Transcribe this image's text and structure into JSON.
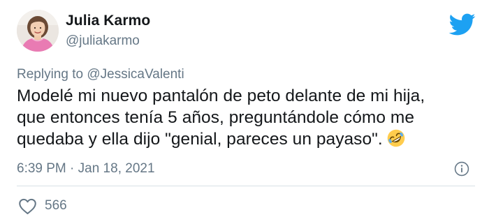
{
  "tweet": {
    "author": {
      "name": "Julia Karmo",
      "handle": "@juliakarmo",
      "avatar_icon": "woman-portrait-avatar"
    },
    "reply": {
      "prefix": "Replying to",
      "mention": "@JessicaValenti"
    },
    "text_lines": [
      "Modelé mi nuevo pantalón de peto delante de mi hija,",
      "que entonces tenía 5 años, preguntándole cómo me",
      "quedaba y ella dijo \"genial, pareces un payaso\"."
    ],
    "emoji": "rolling-on-floor-laughing-emoji",
    "timestamp": "6:39 PM · Jan 18, 2021",
    "likes": "566",
    "icons": {
      "brand": "twitter-bird-icon",
      "info": "info-icon",
      "like": "heart-icon"
    },
    "colors": {
      "brand_blue": "#1DA1F2",
      "text": "#14171A",
      "muted": "#657786",
      "divider": "#D8E0E6"
    }
  }
}
